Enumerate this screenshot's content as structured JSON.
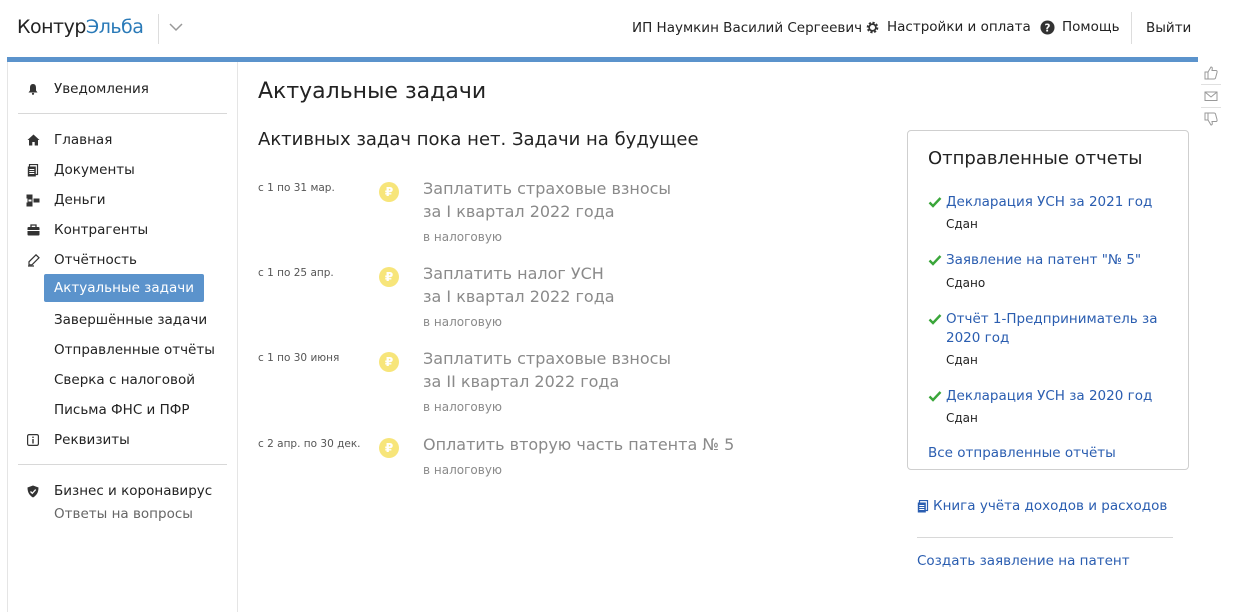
{
  "header": {
    "logo_part1": "Контур",
    "logo_part2": "Эльба",
    "user_name": "ИП Наумкин Василий Сергеевич",
    "settings_label": "Настройки и оплата",
    "help_label": "Помощь",
    "logout_label": "Выйти"
  },
  "sidebar": {
    "notifications": "Уведомления",
    "items": [
      {
        "label": "Главная",
        "icon": "home-icon"
      },
      {
        "label": "Документы",
        "icon": "documents-icon"
      },
      {
        "label": "Деньги",
        "icon": "money-icon"
      },
      {
        "label": "Контрагенты",
        "icon": "briefcase-icon"
      },
      {
        "label": "Отчётность",
        "icon": "reports-icon"
      }
    ],
    "sub_items": [
      {
        "label": "Актуальные задачи",
        "active": true
      },
      {
        "label": "Завершённые задачи",
        "active": false
      },
      {
        "label": "Отправленные отчёты",
        "active": false
      },
      {
        "label": "Сверка с налоговой",
        "active": false
      },
      {
        "label": "Письма ФНС и ПФР",
        "active": false
      }
    ],
    "requisites": "Реквизиты",
    "business": "Бизнес и коронавирус",
    "faq": "Ответы на вопросы"
  },
  "main": {
    "title": "Актуальные задачи",
    "section_title": "Активных задач пока нет. Задачи на будущее",
    "tasks": [
      {
        "date": "с 1 по 31 мар.",
        "line1": "Заплатить страховые взносы",
        "line2": "за I квартал 2022 года",
        "dest": "в налоговую"
      },
      {
        "date": "с 1 по 25 апр.",
        "line1": "Заплатить налог УСН",
        "line2": "за I квартал 2022 года",
        "dest": "в налоговую"
      },
      {
        "date": "с 1 по 30 июня",
        "line1": "Заплатить страховые взносы",
        "line2": "за II квартал 2022 года",
        "dest": "в налоговую"
      },
      {
        "date": "с 2 апр. по 30 дек.",
        "line1": "Оплатить вторую часть патента № 5",
        "line2": "",
        "dest": "в налоговую"
      }
    ],
    "coin_symbol": "₽"
  },
  "reports": {
    "title": "Отправленные отчеты",
    "items": [
      {
        "label": "Декларация УСН за 2021 год",
        "status": "Сдан"
      },
      {
        "label": "Заявление на патент \"№ 5\"",
        "status": "Сдано"
      },
      {
        "label": "Отчёт 1-Предприниматель за 2020 год",
        "status": "Сдан"
      },
      {
        "label": "Декларация УСН за 2020 год",
        "status": "Сдан"
      }
    ],
    "all_label": "Все отправленные отчёты"
  },
  "links": {
    "book": "Книга учёта доходов и расходов",
    "patent": "Создать заявление на патент"
  },
  "colors": {
    "accent": "#5b93cc",
    "link": "#2a5db0",
    "check": "#3aa63a",
    "coin": "#f7e57a"
  }
}
